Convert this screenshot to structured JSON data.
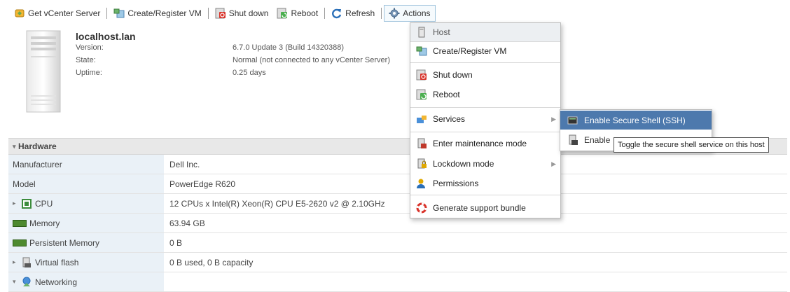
{
  "toolbar": {
    "get_vcenter": "Get vCenter Server",
    "create_register": "Create/Register VM",
    "shut_down": "Shut down",
    "reboot": "Reboot",
    "refresh": "Refresh",
    "actions": "Actions"
  },
  "host": {
    "name": "localhost.lan",
    "version_label": "Version:",
    "version_value": "6.7.0 Update 3 (Build 14320388)",
    "state_label": "State:",
    "state_value": "Normal (not connected to any vCenter Server)",
    "uptime_label": "Uptime:",
    "uptime_value": "0.25 days"
  },
  "hardware": {
    "title": "Hardware",
    "rows": [
      {
        "label": "Manufacturer",
        "value": "Dell Inc."
      },
      {
        "label": "Model",
        "value": "PowerEdge R620"
      },
      {
        "label": "CPU",
        "value": "12 CPUs x Intel(R) Xeon(R) CPU E5-2620 v2 @ 2.10GHz"
      },
      {
        "label": "Memory",
        "value": "63.94 GB"
      },
      {
        "label": "Persistent Memory",
        "value": "0 B"
      },
      {
        "label": "Virtual flash",
        "value": "0 B used, 0 B capacity"
      },
      {
        "label": "Networking",
        "value": ""
      }
    ]
  },
  "menu": {
    "header": "Host",
    "items": [
      "Create/Register VM",
      "Shut down",
      "Reboot",
      "Services",
      "Enter maintenance mode",
      "Lockdown mode",
      "Permissions",
      "Generate support bundle"
    ]
  },
  "submenu": {
    "items": [
      "Enable Secure Shell (SSH)",
      "Enable"
    ]
  },
  "tooltip": "Toggle the secure shell service on this host",
  "colors": {
    "highlight": "#4d79ad",
    "label_bg": "#eaf1f7",
    "memory_icon": "#4e8a2f"
  }
}
